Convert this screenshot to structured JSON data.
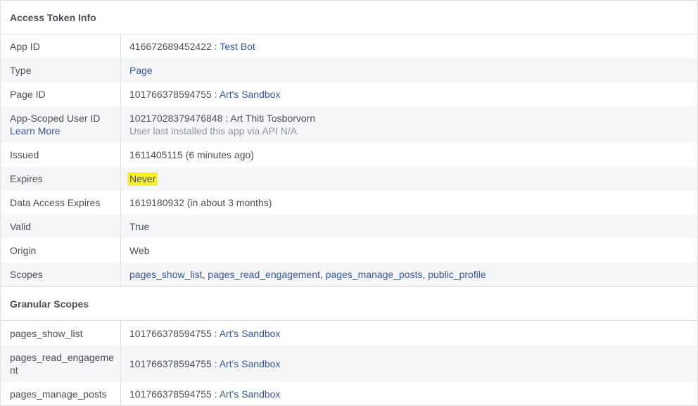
{
  "token_info": {
    "title": "Access Token Info",
    "app_id": {
      "label": "App ID",
      "id": "416672689452422",
      "sep": " : ",
      "app_name": "Test Bot"
    },
    "type": {
      "label": "Type",
      "value": "Page"
    },
    "page_id": {
      "label": "Page ID",
      "id": "101766378594755",
      "sep": " : ",
      "page_name": "Art's Sandbox"
    },
    "app_scoped_user": {
      "label": "App-Scoped User ID",
      "learn_more": "Learn More",
      "id_and_name": "10217028379476848 : Art Thiti Tosborvorn",
      "note": "User last installed this app via API N/A"
    },
    "issued": {
      "label": "Issued",
      "value": "1611405115 (6 minutes ago)"
    },
    "expires": {
      "label": "Expires",
      "value": "Never"
    },
    "data_access_expires": {
      "label": "Data Access Expires",
      "value": "1619180932 (in about 3 months)"
    },
    "valid": {
      "label": "Valid",
      "value": "True"
    },
    "origin": {
      "label": "Origin",
      "value": "Web"
    },
    "scopes": {
      "label": "Scopes",
      "items": [
        "pages_show_list",
        "pages_read_engagement",
        "pages_manage_posts",
        "public_profile"
      ],
      "separator": ", "
    }
  },
  "granular_scopes": {
    "title": "Granular Scopes",
    "rows": [
      {
        "scope": "pages_show_list",
        "id": "101766378594755",
        "sep": " : ",
        "page_name": "Art's Sandbox"
      },
      {
        "scope": "pages_read_engagement",
        "id": "101766378594755",
        "sep": " : ",
        "page_name": "Art's Sandbox"
      },
      {
        "scope": "pages_manage_posts",
        "id": "101766378594755",
        "sep": " : ",
        "page_name": "Art's Sandbox"
      }
    ]
  },
  "colors": {
    "link": "#385898",
    "highlight": "#f8f028",
    "alt_row": "#f5f6f7",
    "border": "#dddfe2"
  }
}
